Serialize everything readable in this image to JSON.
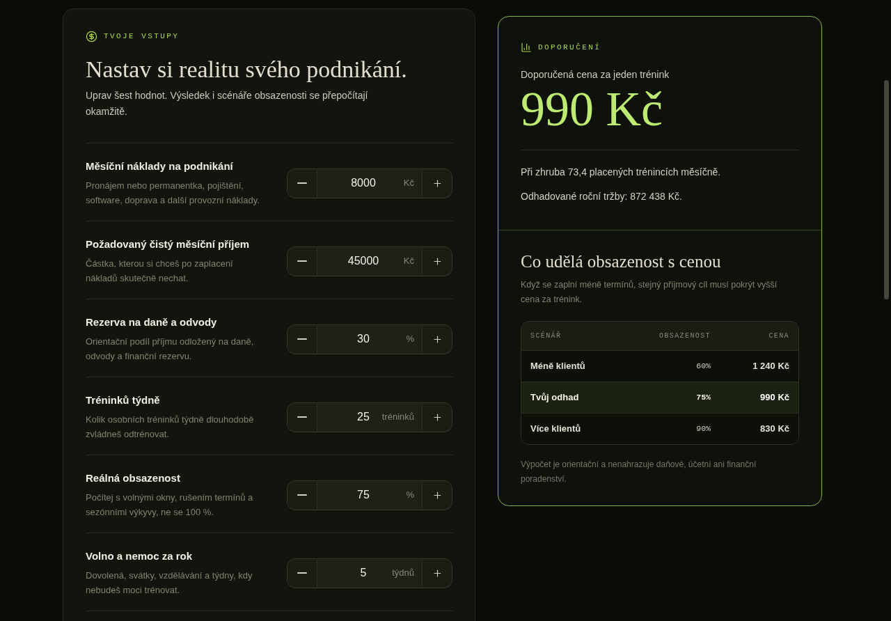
{
  "inputs_panel": {
    "eyebrow": "TVOJE VSTUPY",
    "title": "Nastav si realitu svého podnikání.",
    "intro": "Uprav šest hodnot. Výsledek i scénáře obsazenosti se přepočítají okamžitě.",
    "fields": [
      {
        "label": "Měsíční náklady na podnikání",
        "description": "Pronájem nebo permanentka, pojištění, software, doprava a další provozní náklady.",
        "value": "8000",
        "unit": "Kč"
      },
      {
        "label": "Požadovaný čistý měsíční příjem",
        "description": "Částka, kterou si chceš po zaplacení nákladů skutečně nechat.",
        "value": "45000",
        "unit": "Kč"
      },
      {
        "label": "Rezerva na daně a odvody",
        "description": "Orientační podíl příjmu odložený na daně, odvody a finanční rezervu.",
        "value": "30",
        "unit": "%"
      },
      {
        "label": "Tréninků týdně",
        "description": "Kolik osobních tréninků týdně dlouhodobě zvládneš odtrénovat.",
        "value": "25",
        "unit": "tréninků"
      },
      {
        "label": "Reálná obsazenost",
        "description": "Počítej s volnými okny, rušením termínů a sezónními výkyvy, ne se 100 %.",
        "value": "75",
        "unit": "%"
      },
      {
        "label": "Volno a nemoc za rok",
        "description": "Dovolená, svátky, vzdělávání a týdny, kdy nebudeš moci trénovat.",
        "value": "5",
        "unit": "týdnů"
      }
    ]
  },
  "recommendation": {
    "eyebrow": "DOPORUČENÍ",
    "price_label": "Doporučená cena za jeden trénink",
    "price": "990 Kč",
    "details": [
      "Při zhruba 73,4 placených trénincích měsíčně.",
      "Odhadované roční tržby: 872 438 Kč."
    ]
  },
  "scenarios": {
    "title": "Co udělá obsazenost s cenou",
    "description": "Když se zaplní méně termínů, stejný příjmový cíl musí pokrýt vyšší cena za trénink.",
    "table": {
      "columns": [
        "SCÉNÁŘ",
        "OBSAZENOST",
        "CENA"
      ],
      "rows": [
        {
          "scenario": "Méně klientů",
          "occupancy": "60%",
          "price": "1 240 Kč",
          "selected": false
        },
        {
          "scenario": "Tvůj odhad",
          "occupancy": "75%",
          "price": "990 Kč",
          "selected": true
        },
        {
          "scenario": "Více klientů",
          "occupancy": "90%",
          "price": "830 Kč",
          "selected": false
        }
      ]
    },
    "footnote": "Výpočet je orientační a nenahrazuje daňové, účetní ani finanční poradenství."
  }
}
